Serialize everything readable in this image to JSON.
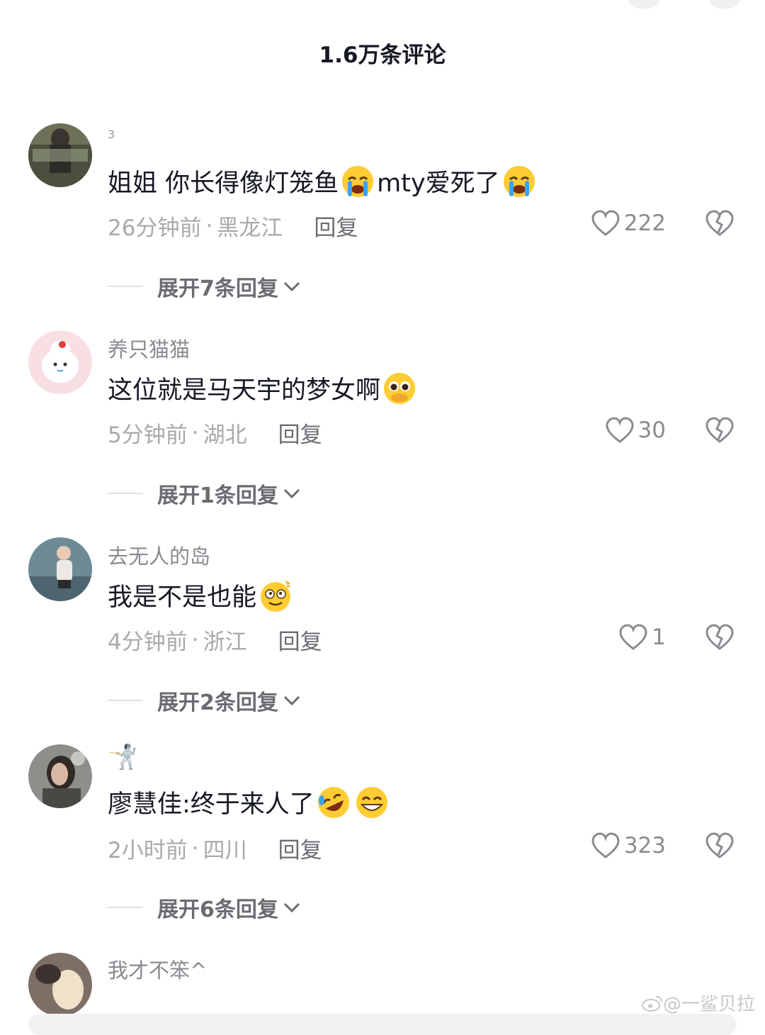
{
  "header": {
    "title": "1.6万条评论"
  },
  "comments": [
    {
      "username": "3",
      "text": "姐姐 你长得像灯笼鱼",
      "text_after_emoji": "mty爱死了",
      "time": "26分钟前",
      "separator": "·",
      "location": "黑龙江",
      "reply_label": "回复",
      "likes": "222",
      "expand_label": "展开7条回复"
    },
    {
      "username": "养只猫猫",
      "text": "这位就是马天宇的梦女啊",
      "time": "5分钟前",
      "separator": "·",
      "location": "湖北",
      "reply_label": "回复",
      "likes": "30",
      "expand_label": "展开1条回复"
    },
    {
      "username": "去无人的岛",
      "text": "我是不是也能",
      "time": "4分钟前",
      "separator": "·",
      "location": "浙江",
      "reply_label": "回复",
      "likes": "1",
      "expand_label": "展开2条回复"
    },
    {
      "username": "🤺",
      "text": "廖慧佳:终于来人了",
      "time": "2小时前",
      "separator": "·",
      "location": "四川",
      "reply_label": "回复",
      "likes": "323",
      "expand_label": "展开6条回复"
    },
    {
      "username": "我才不笨^"
    }
  ],
  "watermark": "@一鲨贝拉",
  "colors": {
    "text": "#161823",
    "muted": "#a8a9ad",
    "reply": "#6b6c72"
  }
}
